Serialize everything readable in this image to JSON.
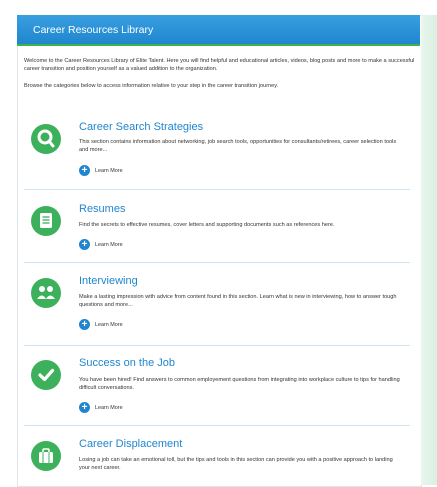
{
  "header": {
    "title": "Career Resources Library"
  },
  "intro": {
    "p1": "Welcome to the Career Resources Library of Elite Talent. Here you will find helpful and educational articles, videos, blog posts and more to make a successful career transition and position yourself as a valued addition to the organization.",
    "p2": "Browse the categories below to access information relative to your step in the career transition journey."
  },
  "sections": [
    {
      "title": "Career Search Strategies",
      "desc": "This section contains information about networking, job search tools, opportunities for consultants/retirees, career selection tools and more...",
      "link": "Learn More",
      "icon": "search-icon"
    },
    {
      "title": "Resumes",
      "desc": "Find the secrets to effective resumes, cover letters and supporting documents such as references here.",
      "link": "Learn More",
      "icon": "document-icon"
    },
    {
      "title": "Interviewing",
      "desc": "Make a lasting impression with advice from content found in this section. Learn what is new in interviewing, how to answer tough questions and more...",
      "link": "Learn More",
      "icon": "people-icon"
    },
    {
      "title": "Success on the Job",
      "desc": "You have been hired! Find answers to common employement questions from integrating into workplace culture to tips for handling difficult conversations.",
      "link": "Learn More",
      "icon": "checkmark-icon"
    },
    {
      "title": "Career Displacement",
      "desc": "Losing a job can take an emotional toll, but the tips and tools in this section can provide you with a positive approach to landing your next career.",
      "link": "Learn More",
      "icon": "briefcase-icon"
    }
  ],
  "colors": {
    "accent": "#1f86cf",
    "icon_bg": "#3cb05b",
    "divider": "#cfe3f2"
  }
}
